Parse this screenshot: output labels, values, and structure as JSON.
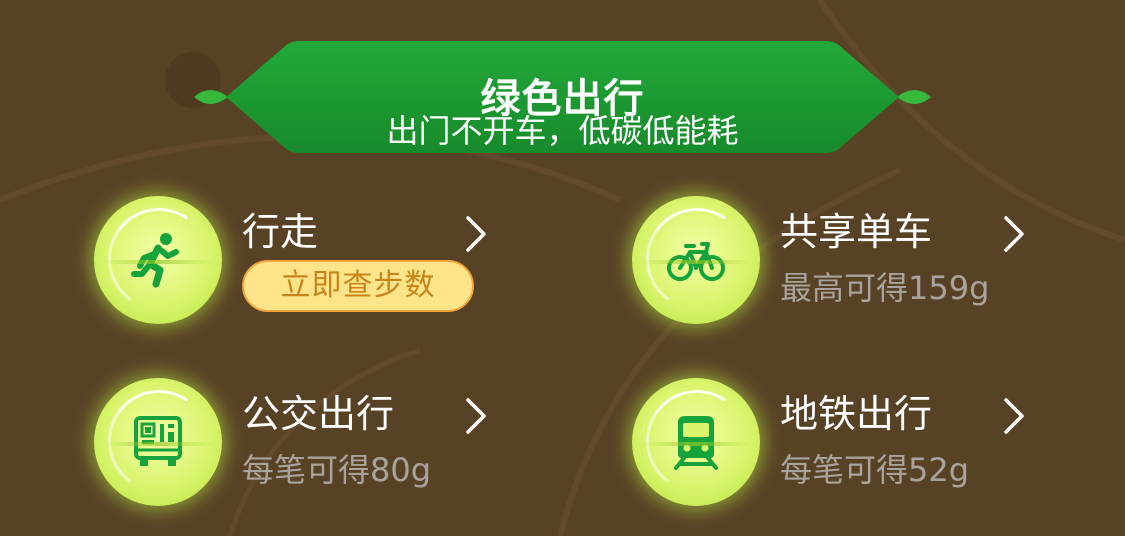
{
  "banner": {
    "title": "绿色出行",
    "subtitle": "出门不开车，低碳低能耗"
  },
  "colors": {
    "background": "#584226",
    "banner_green": "#1d9a33",
    "icon_green": "#17a33c",
    "orb_light": "#f4ffa8",
    "pill_bg": "#ffe48a",
    "pill_border": "#f3a53a",
    "pill_text": "#c98519",
    "subtitle_gray": "#a8a39c"
  },
  "cards": [
    {
      "title": "行走",
      "action_label": "立即查步数",
      "icon": "running-person-icon"
    },
    {
      "title": "共享单车",
      "subtitle": "最高可得159g",
      "icon": "bicycle-icon"
    },
    {
      "title": "公交出行",
      "subtitle": "每笔可得80g",
      "icon": "bus-icon"
    },
    {
      "title": "地铁出行",
      "subtitle": "每笔可得52g",
      "icon": "train-icon"
    }
  ]
}
